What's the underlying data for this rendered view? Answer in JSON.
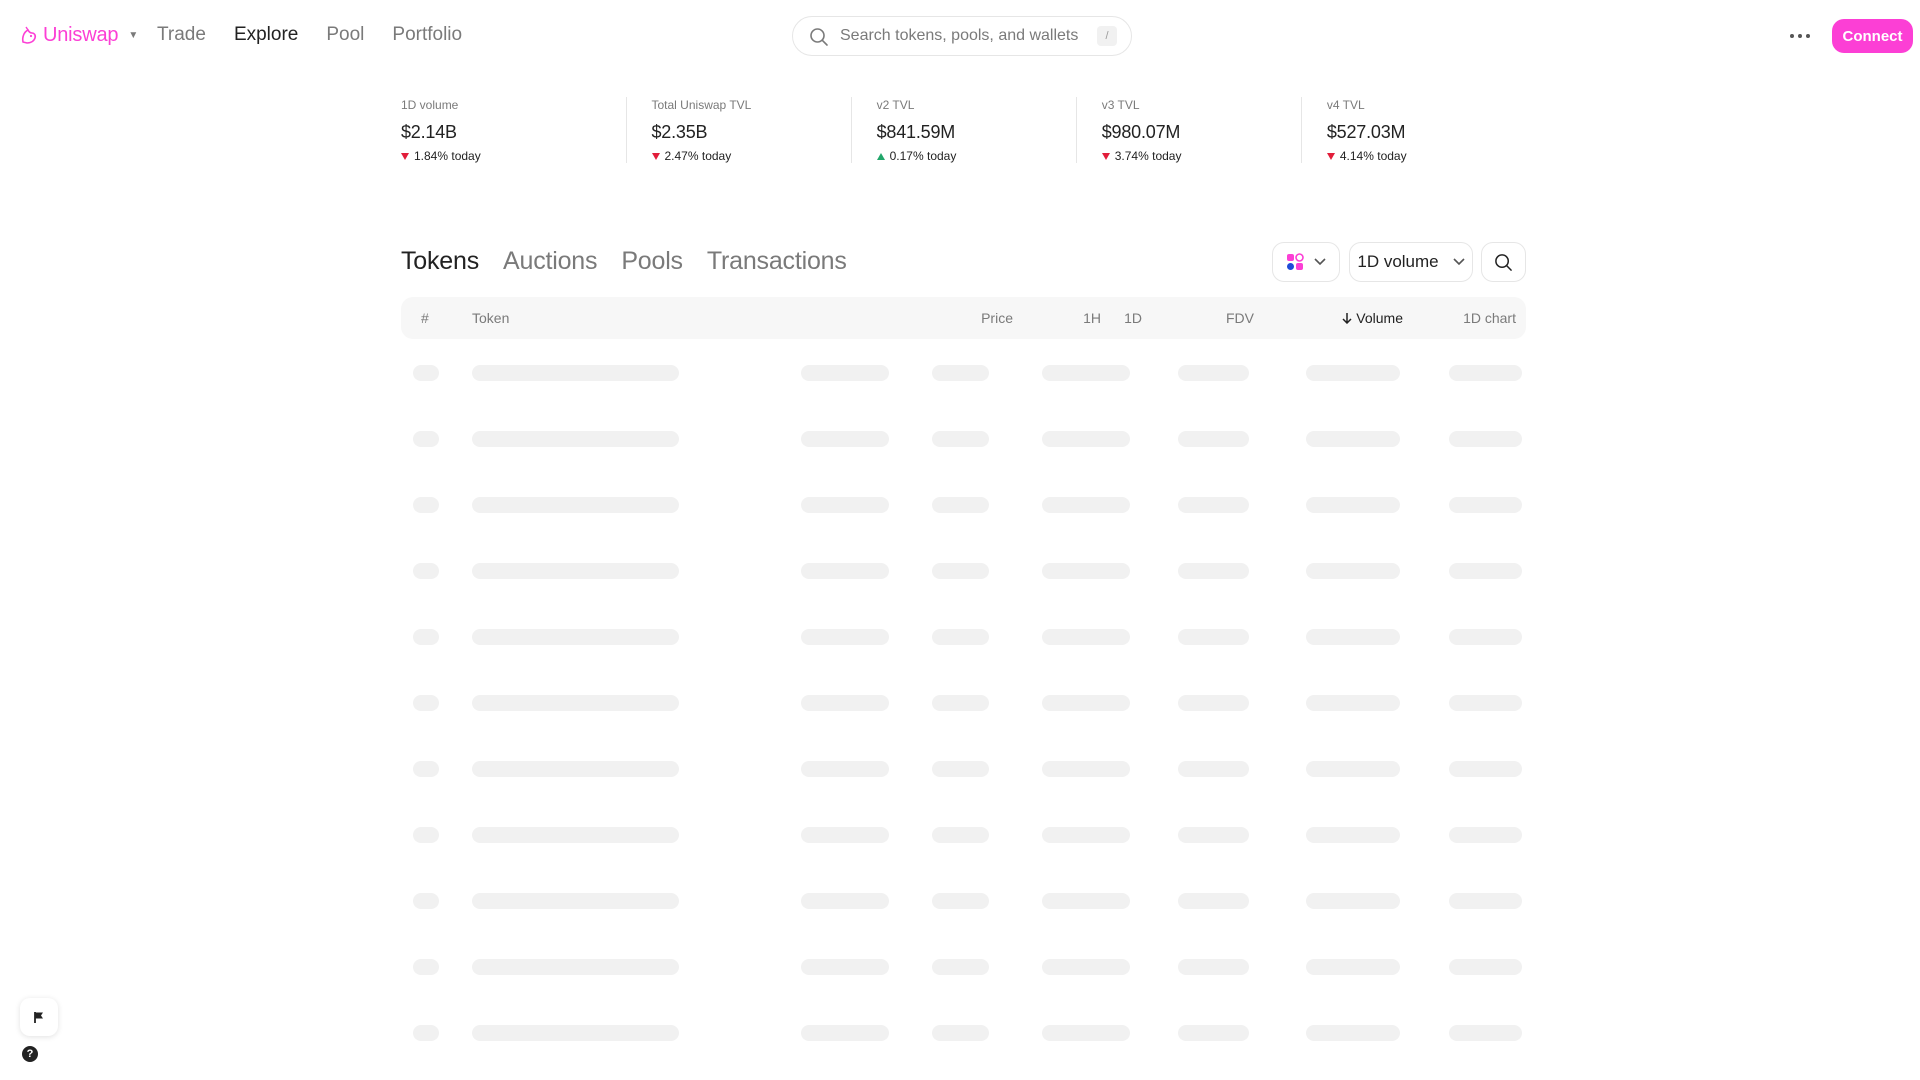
{
  "app": {
    "name": "Uniswap",
    "brand_color": "#fc3fd5",
    "logo_icon": "unicorn-logo-icon"
  },
  "nav": {
    "items": [
      {
        "label": "Trade",
        "active": false
      },
      {
        "label": "Explore",
        "active": true
      },
      {
        "label": "Pool",
        "active": false
      },
      {
        "label": "Portfolio",
        "active": false
      }
    ],
    "search_placeholder": "Search tokens, pools, and wallets",
    "search_shortcut": "/",
    "connect_label": "Connect"
  },
  "stats": [
    {
      "label": "1D volume",
      "value": "$2.14B",
      "change": "1.84% today",
      "direction": "down"
    },
    {
      "label": "Total Uniswap TVL",
      "value": "$2.35B",
      "change": "2.47% today",
      "direction": "down"
    },
    {
      "label": "v2 TVL",
      "value": "$841.59M",
      "change": "0.17% today",
      "direction": "up"
    },
    {
      "label": "v3 TVL",
      "value": "$980.07M",
      "change": "3.74% today",
      "direction": "down"
    },
    {
      "label": "v4 TVL",
      "value": "$527.03M",
      "change": "4.14% today",
      "direction": "down"
    }
  ],
  "colors": {
    "down": "#e21d3a",
    "up": "#21a66a"
  },
  "tabs": [
    {
      "label": "Tokens",
      "active": true
    },
    {
      "label": "Auctions",
      "active": false
    },
    {
      "label": "Pools",
      "active": false
    },
    {
      "label": "Transactions",
      "active": false
    }
  ],
  "toolbar": {
    "network_icon": "all-networks-icon",
    "volume_selector_value": "1D volume"
  },
  "table": {
    "columns": {
      "rank": "#",
      "token": "Token",
      "price": "Price",
      "h1": "1H",
      "d1": "1D",
      "fdv": "FDV",
      "volume": "Volume",
      "chart": "1D chart"
    },
    "sorted_by": "volume",
    "sort_direction": "descending",
    "loading_rows": 11
  },
  "floating": {
    "feedback_icon": "flag-icon",
    "help_glyph": "?"
  }
}
